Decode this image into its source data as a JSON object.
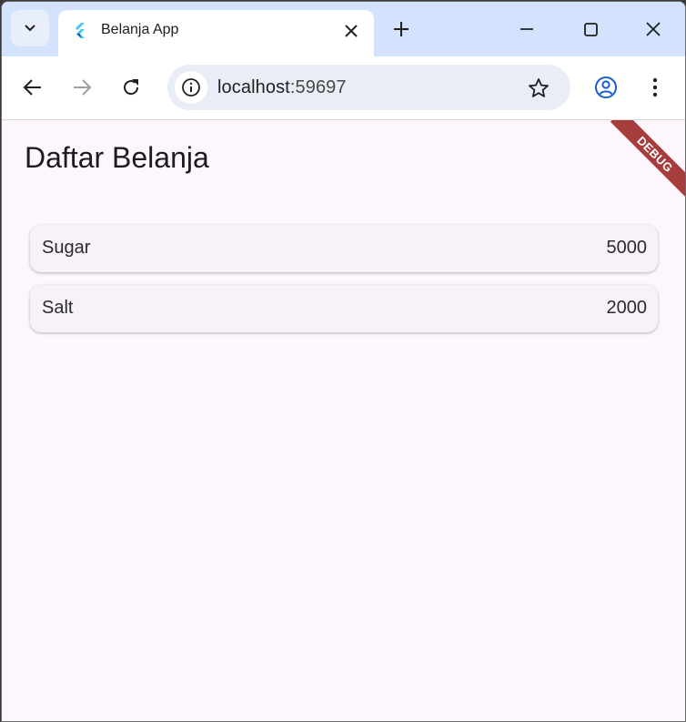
{
  "browser": {
    "tab_title": "Belanja App",
    "url_host": "localhost",
    "url_port": ":59697"
  },
  "app": {
    "title": "Daftar Belanja",
    "debug_label": "DEBUG",
    "items": [
      {
        "name": "Sugar",
        "price": "5000"
      },
      {
        "name": "Salt",
        "price": "2000"
      }
    ]
  },
  "colors": {
    "tabstrip": "#d3e3fd",
    "page_background": "#fdf6fd",
    "card": "#f7f2fa",
    "debug_banner": "#a63d3d",
    "profile_icon": "#1a5ccc"
  }
}
